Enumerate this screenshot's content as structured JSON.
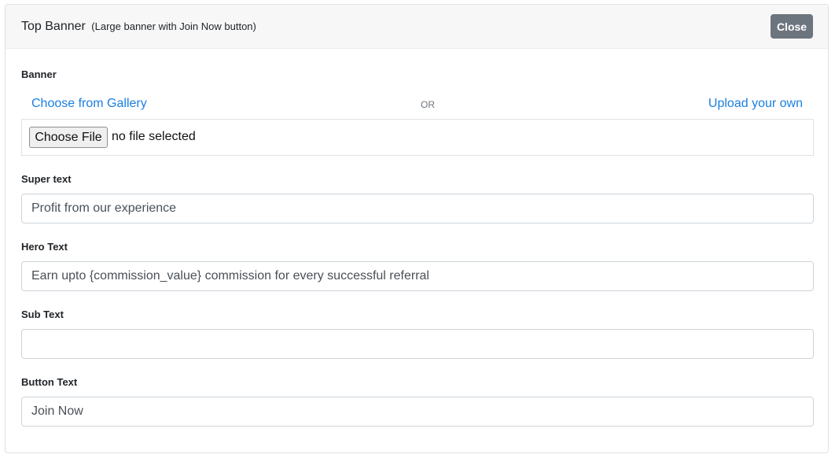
{
  "header": {
    "title": "Top Banner",
    "subtitle": "(Large banner with Join Now button)",
    "close_label": "Close"
  },
  "banner": {
    "label": "Banner",
    "gallery_link": "Choose from Gallery",
    "or_text": "OR",
    "upload_link": "Upload your own",
    "file_button": "Choose File",
    "file_status": "no file selected"
  },
  "fields": {
    "super_text": {
      "label": "Super text",
      "value": "Profit from our experience"
    },
    "hero_text": {
      "label": "Hero Text",
      "value": "Earn upto {commission_value} commission for every successful referral"
    },
    "sub_text": {
      "label": "Sub Text",
      "value": ""
    },
    "button_text": {
      "label": "Button Text",
      "value": "Join Now"
    }
  },
  "colors": {
    "link": "#1a7fe0",
    "close_button": "#6c757d",
    "header_bg": "#f7f7f7"
  }
}
